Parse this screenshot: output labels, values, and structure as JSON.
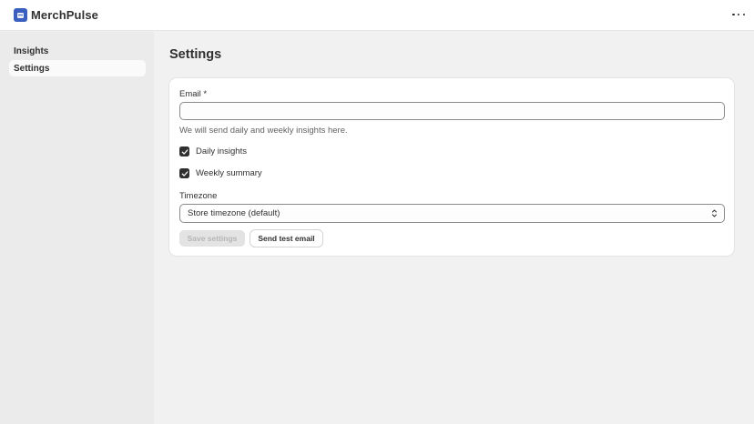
{
  "app": {
    "title": "MerchPulse",
    "logo_icon": "merchpulse-logo-icon",
    "more_icon": "more-horizontal-icon"
  },
  "sidebar": {
    "items": [
      {
        "label": "Insights",
        "active": false
      },
      {
        "label": "Settings",
        "active": true
      }
    ]
  },
  "page": {
    "title": "Settings"
  },
  "form": {
    "email": {
      "label": "Email *",
      "value": "",
      "placeholder": "",
      "help": "We will send daily and weekly insights here."
    },
    "daily": {
      "label": "Daily insights",
      "checked": true
    },
    "weekly": {
      "label": "Weekly summary",
      "checked": true
    },
    "timezone": {
      "label": "Timezone",
      "selected": "Store timezone (default)",
      "icon": "select-chevron-icon"
    },
    "save_label": "Save settings",
    "test_label": "Send test email"
  },
  "colors": {
    "brand": "#3b5fbf",
    "text": "#303030",
    "disabled_text": "#b5b5b5"
  }
}
